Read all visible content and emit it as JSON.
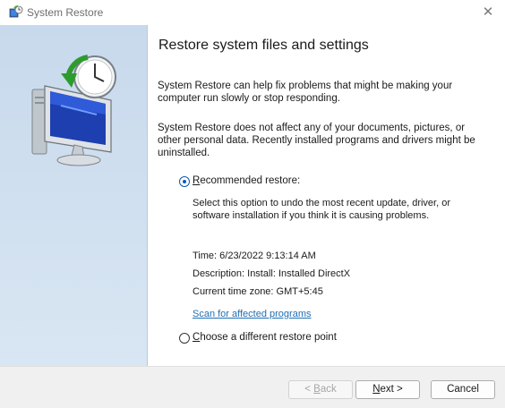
{
  "window": {
    "title": "System Restore",
    "close_glyph": "✕"
  },
  "content": {
    "heading": "Restore system files and settings",
    "para1": "System Restore can help fix problems that might be making your computer run slowly or stop responding.",
    "para2": "System Restore does not affect any of your documents, pictures, or other personal data. Recently installed programs and drivers might be uninstalled.",
    "recommended": {
      "label_prefix": "R",
      "label_rest": "ecommended restore:",
      "selected": true,
      "description": "Select this option to undo the most recent update, driver, or software installation if you think it is causing problems.",
      "time": "Time: 6/23/2022 9:13:14 AM",
      "desc_line": "Description: Install: Installed DirectX",
      "timezone": "Current time zone: GMT+5:45",
      "scan_link": "Scan for affected programs"
    },
    "choose_other": {
      "label_prefix": "C",
      "label_rest": "hoose a different restore point",
      "selected": false
    }
  },
  "footer": {
    "back": {
      "pre": "< ",
      "u": "B",
      "rest": "ack"
    },
    "next": {
      "u": "N",
      "rest": "ext >"
    },
    "cancel": "Cancel"
  },
  "icons": [
    "system-restore-icon",
    "close-icon",
    "computer-clock-illustration"
  ],
  "colors": {
    "sidepanel": "#cfdff0",
    "accent": "#0a5ab4",
    "link": "#1f6fb5"
  }
}
